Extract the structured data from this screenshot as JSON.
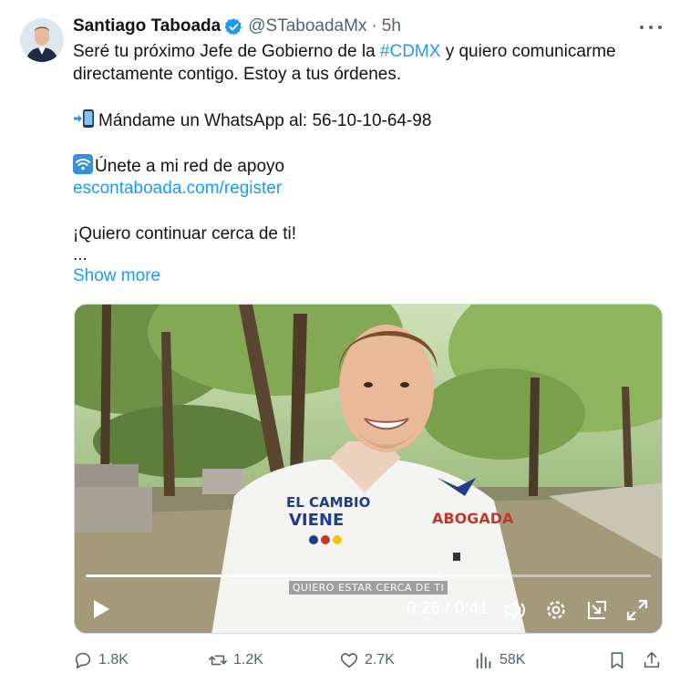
{
  "author": {
    "display_name": "Santiago Taboada",
    "handle": "@STaboadaMx",
    "separator": "·",
    "time": "5h"
  },
  "tweet": {
    "line1_a": "Seré tu próximo Jefe de Gobierno de la ",
    "hashtag": "#CDMX",
    "line1_b": " y quiero comunicarme",
    "line2": "directamente contigo. Estoy a tus órdenes.",
    "line3": "Mándame un WhatsApp al: 56-10-10-64-98",
    "line4": "Únete a mi red de apoyo",
    "link": "escontaboada.com/register",
    "line5": "¡Quiero continuar cerca de ti!",
    "ellipsis": "...",
    "show_more": "Show more"
  },
  "video": {
    "caption": "QUIERO ESTAR CERCA DE TI",
    "current_time": "0:26",
    "duration": "0:41",
    "time_separator": " / ",
    "progress_fraction": 0.63,
    "shirt_left_text_1": "EL CAMBIO",
    "shirt_left_text_2": "VIENE",
    "shirt_right_text": "ABOGADA"
  },
  "actions": {
    "replies": "1.8K",
    "reposts": "1.2K",
    "likes": "2.7K",
    "views": "58K"
  },
  "colors": {
    "accent": "#1d9bf0",
    "text": "#0f1419",
    "secondary": "#536471"
  },
  "icons": [
    "verified-badge-icon",
    "more-icon",
    "phone-arrow-icon",
    "wifi-icon",
    "play-icon",
    "volume-icon",
    "settings-icon",
    "pip-icon",
    "fullscreen-icon",
    "reply-icon",
    "repost-icon",
    "like-icon",
    "views-icon",
    "bookmark-icon",
    "share-icon"
  ]
}
